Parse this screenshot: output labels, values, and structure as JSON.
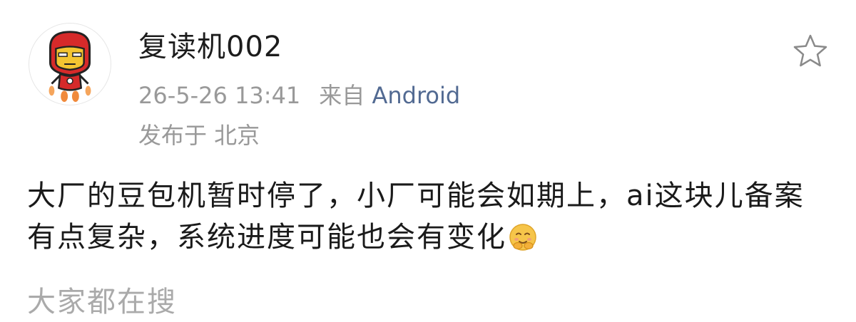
{
  "post": {
    "author": {
      "name": "复读机002",
      "avatar_icon": "iron-man-cartoon-avatar"
    },
    "meta": {
      "timestamp": "26-5-26 13:41",
      "source_prefix": "来自",
      "device": "Android",
      "device_color": "#526a92",
      "location": "发布于 北京"
    },
    "favorite_icon": "star-outline-icon",
    "content": {
      "text": "大厂的豆包机暂时停了，小厂可能会如期上，ai这块儿备案有点复杂，系统进度可能也会有变化",
      "emoji_icon": "hug-face-emoji"
    }
  },
  "section": {
    "title": "大家都在搜"
  }
}
